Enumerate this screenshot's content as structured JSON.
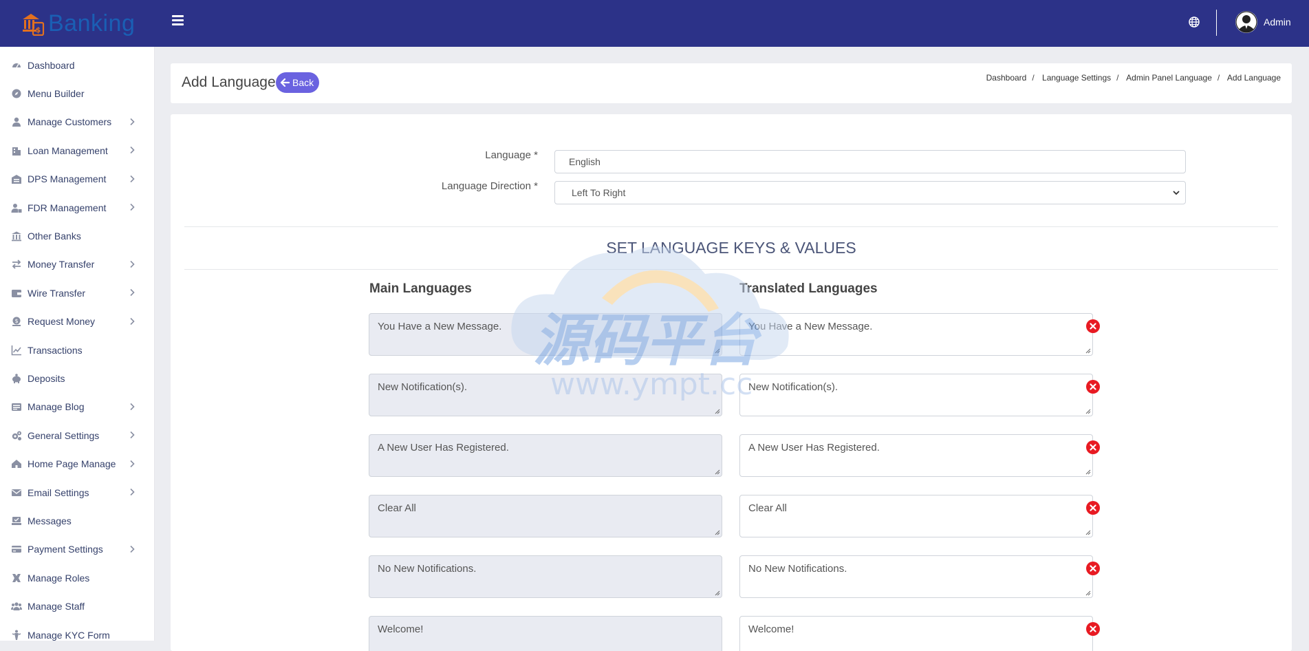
{
  "brand": {
    "name": "Banking"
  },
  "header": {
    "user_name": "Admin",
    "menu_icon": "hamburger-icon",
    "language_icon": "globe-icon"
  },
  "sidebar": {
    "items": [
      {
        "label": "Dashboard",
        "icon": "dashboard-icon",
        "has_submenu": false
      },
      {
        "label": "Menu Builder",
        "icon": "compass-icon",
        "has_submenu": false
      },
      {
        "label": "Manage Customers",
        "icon": "user-icon",
        "has_submenu": true
      },
      {
        "label": "Loan Management",
        "icon": "building-icon",
        "has_submenu": true
      },
      {
        "label": "DPS Management",
        "icon": "warehouse-icon",
        "has_submenu": true
      },
      {
        "label": "FDR Management",
        "icon": "user-lock-icon",
        "has_submenu": true
      },
      {
        "label": "Other Banks",
        "icon": "bank-icon",
        "has_submenu": false
      },
      {
        "label": "Money Transfer",
        "icon": "exchange-icon",
        "has_submenu": true
      },
      {
        "label": "Wire Transfer",
        "icon": "wallet-icon",
        "has_submenu": true
      },
      {
        "label": "Request Money",
        "icon": "money-request-icon",
        "has_submenu": true
      },
      {
        "label": "Transactions",
        "icon": "chart-line-icon",
        "has_submenu": false
      },
      {
        "label": "Deposits",
        "icon": "piggy-bank-icon",
        "has_submenu": false
      },
      {
        "label": "Manage Blog",
        "icon": "blog-icon",
        "has_submenu": true
      },
      {
        "label": "General Settings",
        "icon": "cogs-icon",
        "has_submenu": true
      },
      {
        "label": "Home Page Manage",
        "icon": "home-icon",
        "has_submenu": true
      },
      {
        "label": "Email Settings",
        "icon": "envelope-icon",
        "has_submenu": true
      },
      {
        "label": "Messages",
        "icon": "message-icon",
        "has_submenu": false
      },
      {
        "label": "Payment Settings",
        "icon": "credit-card-icon",
        "has_submenu": true
      },
      {
        "label": "Manage Roles",
        "icon": "roles-icon",
        "has_submenu": false
      },
      {
        "label": "Manage Staff",
        "icon": "users-icon",
        "has_submenu": false
      },
      {
        "label": "Manage KYC Form",
        "icon": "kyc-icon",
        "has_submenu": false
      }
    ]
  },
  "page": {
    "title": "Add Language",
    "back_label": "Back",
    "breadcrumb": [
      "Dashboard",
      "Language Settings",
      "Admin Panel Language",
      "Add Language"
    ]
  },
  "form": {
    "language_label": "Language *",
    "language_value": "English",
    "direction_label": "Language Direction *",
    "direction_value": "Left To Right",
    "section_title": "SET LANGUAGE KEYS & VALUES",
    "main_col_title": "Main Languages",
    "trans_col_title": "Translated Languages",
    "rows": [
      {
        "main": "You Have a New Message.",
        "translated": "You Have a New Message."
      },
      {
        "main": "New Notification(s).",
        "translated": "New Notification(s)."
      },
      {
        "main": "A New User Has Registered.",
        "translated": "A New User Has Registered."
      },
      {
        "main": "Clear All",
        "translated": "Clear All"
      },
      {
        "main": "No New Notifications.",
        "translated": "No New Notifications."
      },
      {
        "main": "Welcome!",
        "translated": "Welcome!"
      }
    ]
  },
  "watermark": {
    "text_cn": "源码平台",
    "url": "www.ympt.cc"
  },
  "colors": {
    "topbar": "#2c3288",
    "accent": "#6a62e0",
    "delete": "#e81a22",
    "readonly_bg": "#e9ebf2"
  }
}
